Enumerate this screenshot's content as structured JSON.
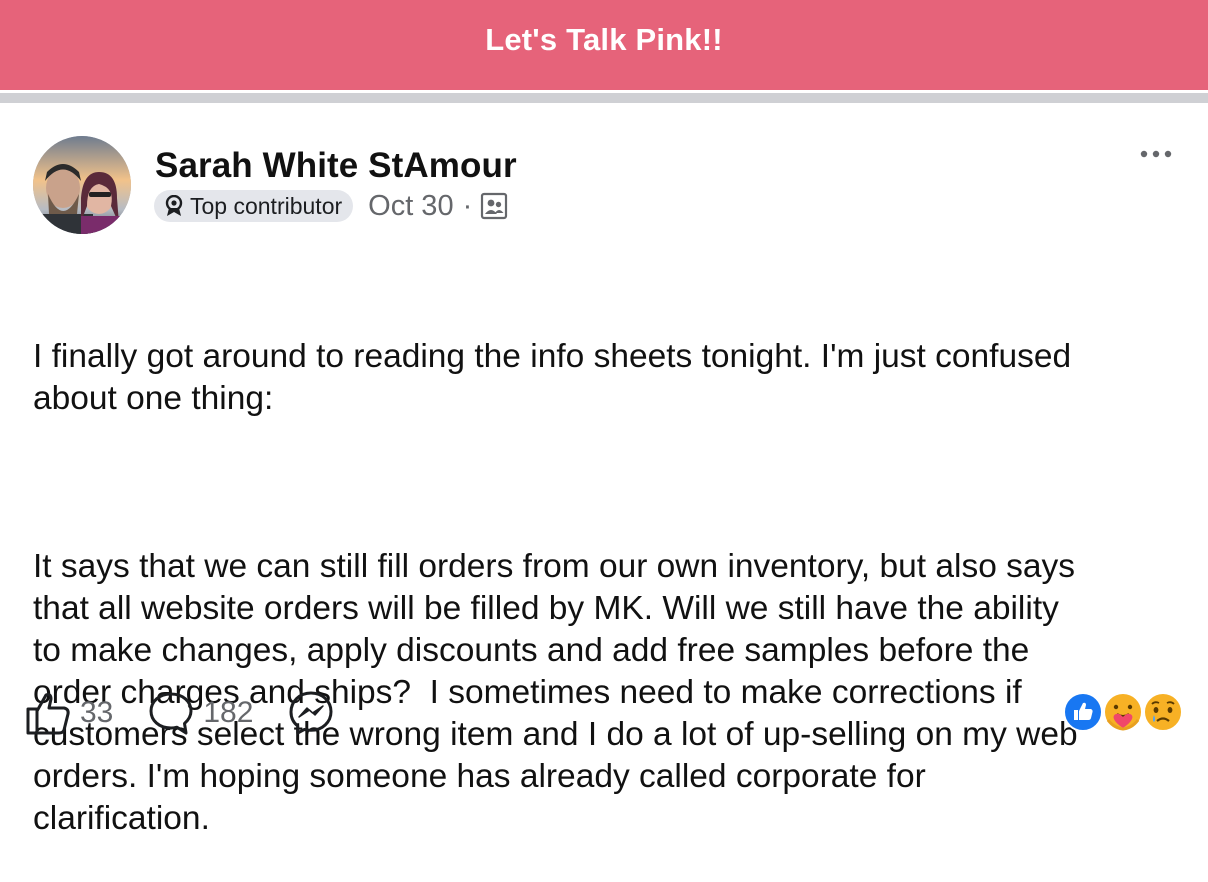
{
  "header": {
    "title": "Let's Talk Pink!!"
  },
  "post": {
    "author": "Sarah White StAmour",
    "badge": "Top contributor",
    "date": "Oct 30",
    "separator": "·",
    "paragraphs": [
      "I finally got around to reading the info sheets tonight. I'm just confused\nabout one thing:",
      "It says that we can still fill orders from our own inventory, but also says\nthat all website orders will be filled by MK. Will we still have the ability\nto make changes, apply discounts and add free samples before the\norder charges and ships?  I sometimes need to make corrections if\ncustomers select the wrong item and I do a lot of up-selling on my web\norders. I'm hoping someone has already called corporate for\nclarification."
    ]
  },
  "actions": {
    "likes": "33",
    "comments": "182"
  },
  "icons": {
    "badge": "top-contributor-icon",
    "audience": "group-members-icon",
    "more": "more-icon",
    "like": "like-icon",
    "comment": "comment-icon",
    "share": "messenger-icon",
    "reactions": [
      "like-reaction-icon",
      "care-reaction-icon",
      "sad-reaction-icon"
    ]
  },
  "colors": {
    "header": "#e6637a",
    "divider": "#cfd0d4",
    "badge_bg": "#e4e6eb",
    "secondary_text": "#65676b",
    "like_blue": "#1877f2"
  }
}
